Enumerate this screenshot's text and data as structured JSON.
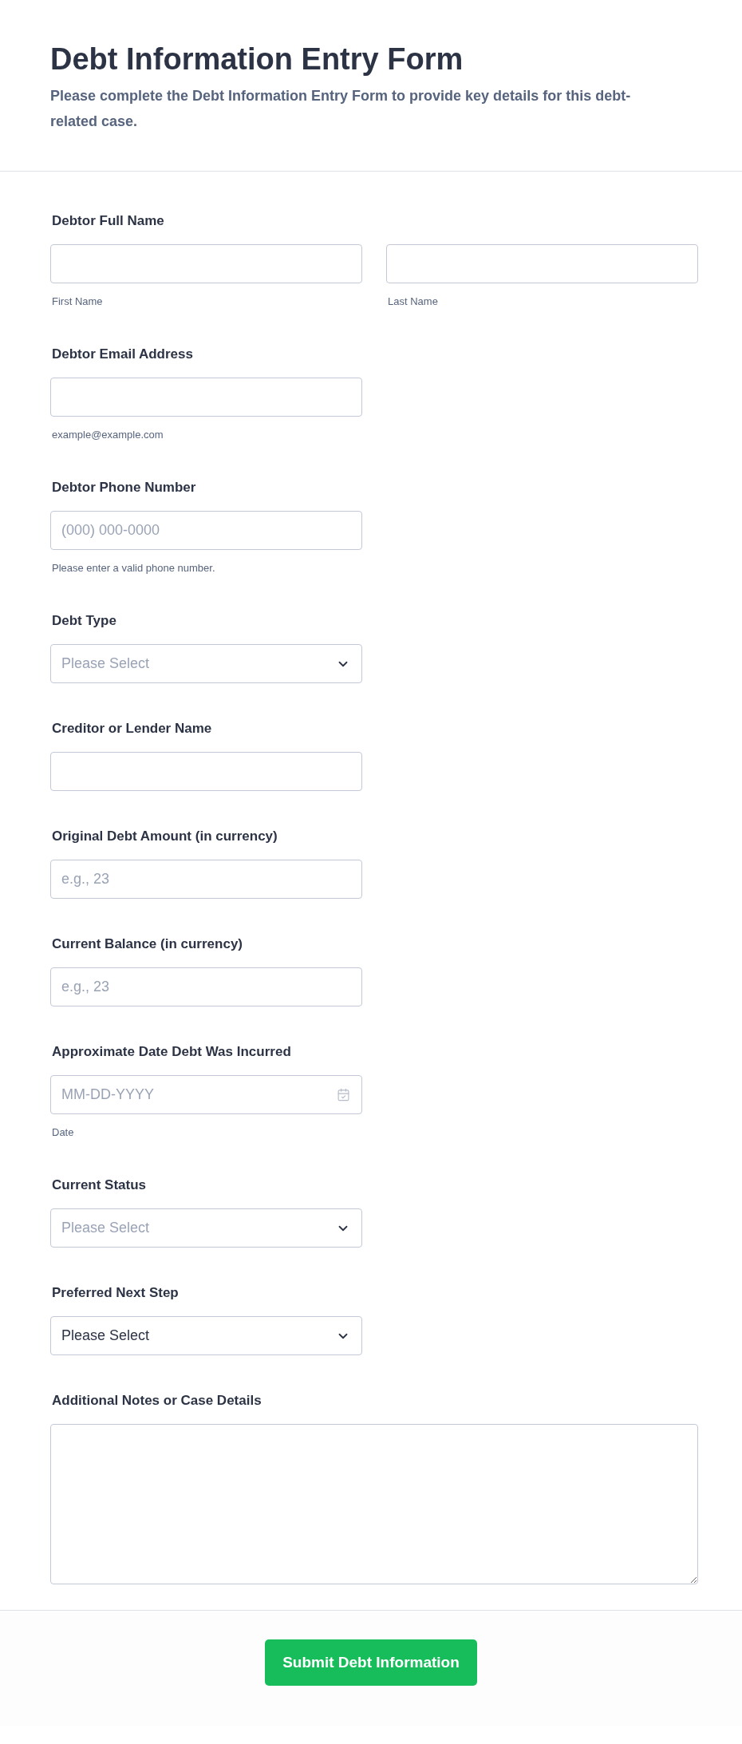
{
  "header": {
    "title": "Debt Information Entry Form",
    "subtitle": "Please complete the Debt Information Entry Form to provide key details for this debt-related case."
  },
  "fields": [
    {
      "kind": "name",
      "label": "Debtor Full Name",
      "sublabels": [
        "First Name",
        "Last Name"
      ]
    },
    {
      "kind": "text",
      "label": "Debtor Email Address",
      "sublabel": "example@example.com"
    },
    {
      "kind": "text",
      "label": "Debtor Phone Number",
      "placeholder": "(000) 000-0000",
      "sublabel": "Please enter a valid phone number."
    },
    {
      "kind": "select",
      "label": "Debt Type",
      "placeholder": "Please Select"
    },
    {
      "kind": "text",
      "label": "Creditor or Lender Name"
    },
    {
      "kind": "text",
      "label": "Original Debt Amount (in currency)",
      "placeholder": "e.g., 23"
    },
    {
      "kind": "text",
      "label": "Current Balance (in currency)",
      "placeholder": "e.g., 23"
    },
    {
      "kind": "date",
      "label": "Approximate Date Debt Was Incurred",
      "placeholder": "MM-DD-YYYY",
      "sublabel": "Date"
    },
    {
      "kind": "select",
      "label": "Current Status",
      "placeholder": "Please Select"
    },
    {
      "kind": "select",
      "label": "Preferred Next Step",
      "value": "Please Select"
    },
    {
      "kind": "textarea",
      "label": "Additional Notes or Case Details"
    }
  ],
  "submit": {
    "label": "Submit Debt Information"
  }
}
